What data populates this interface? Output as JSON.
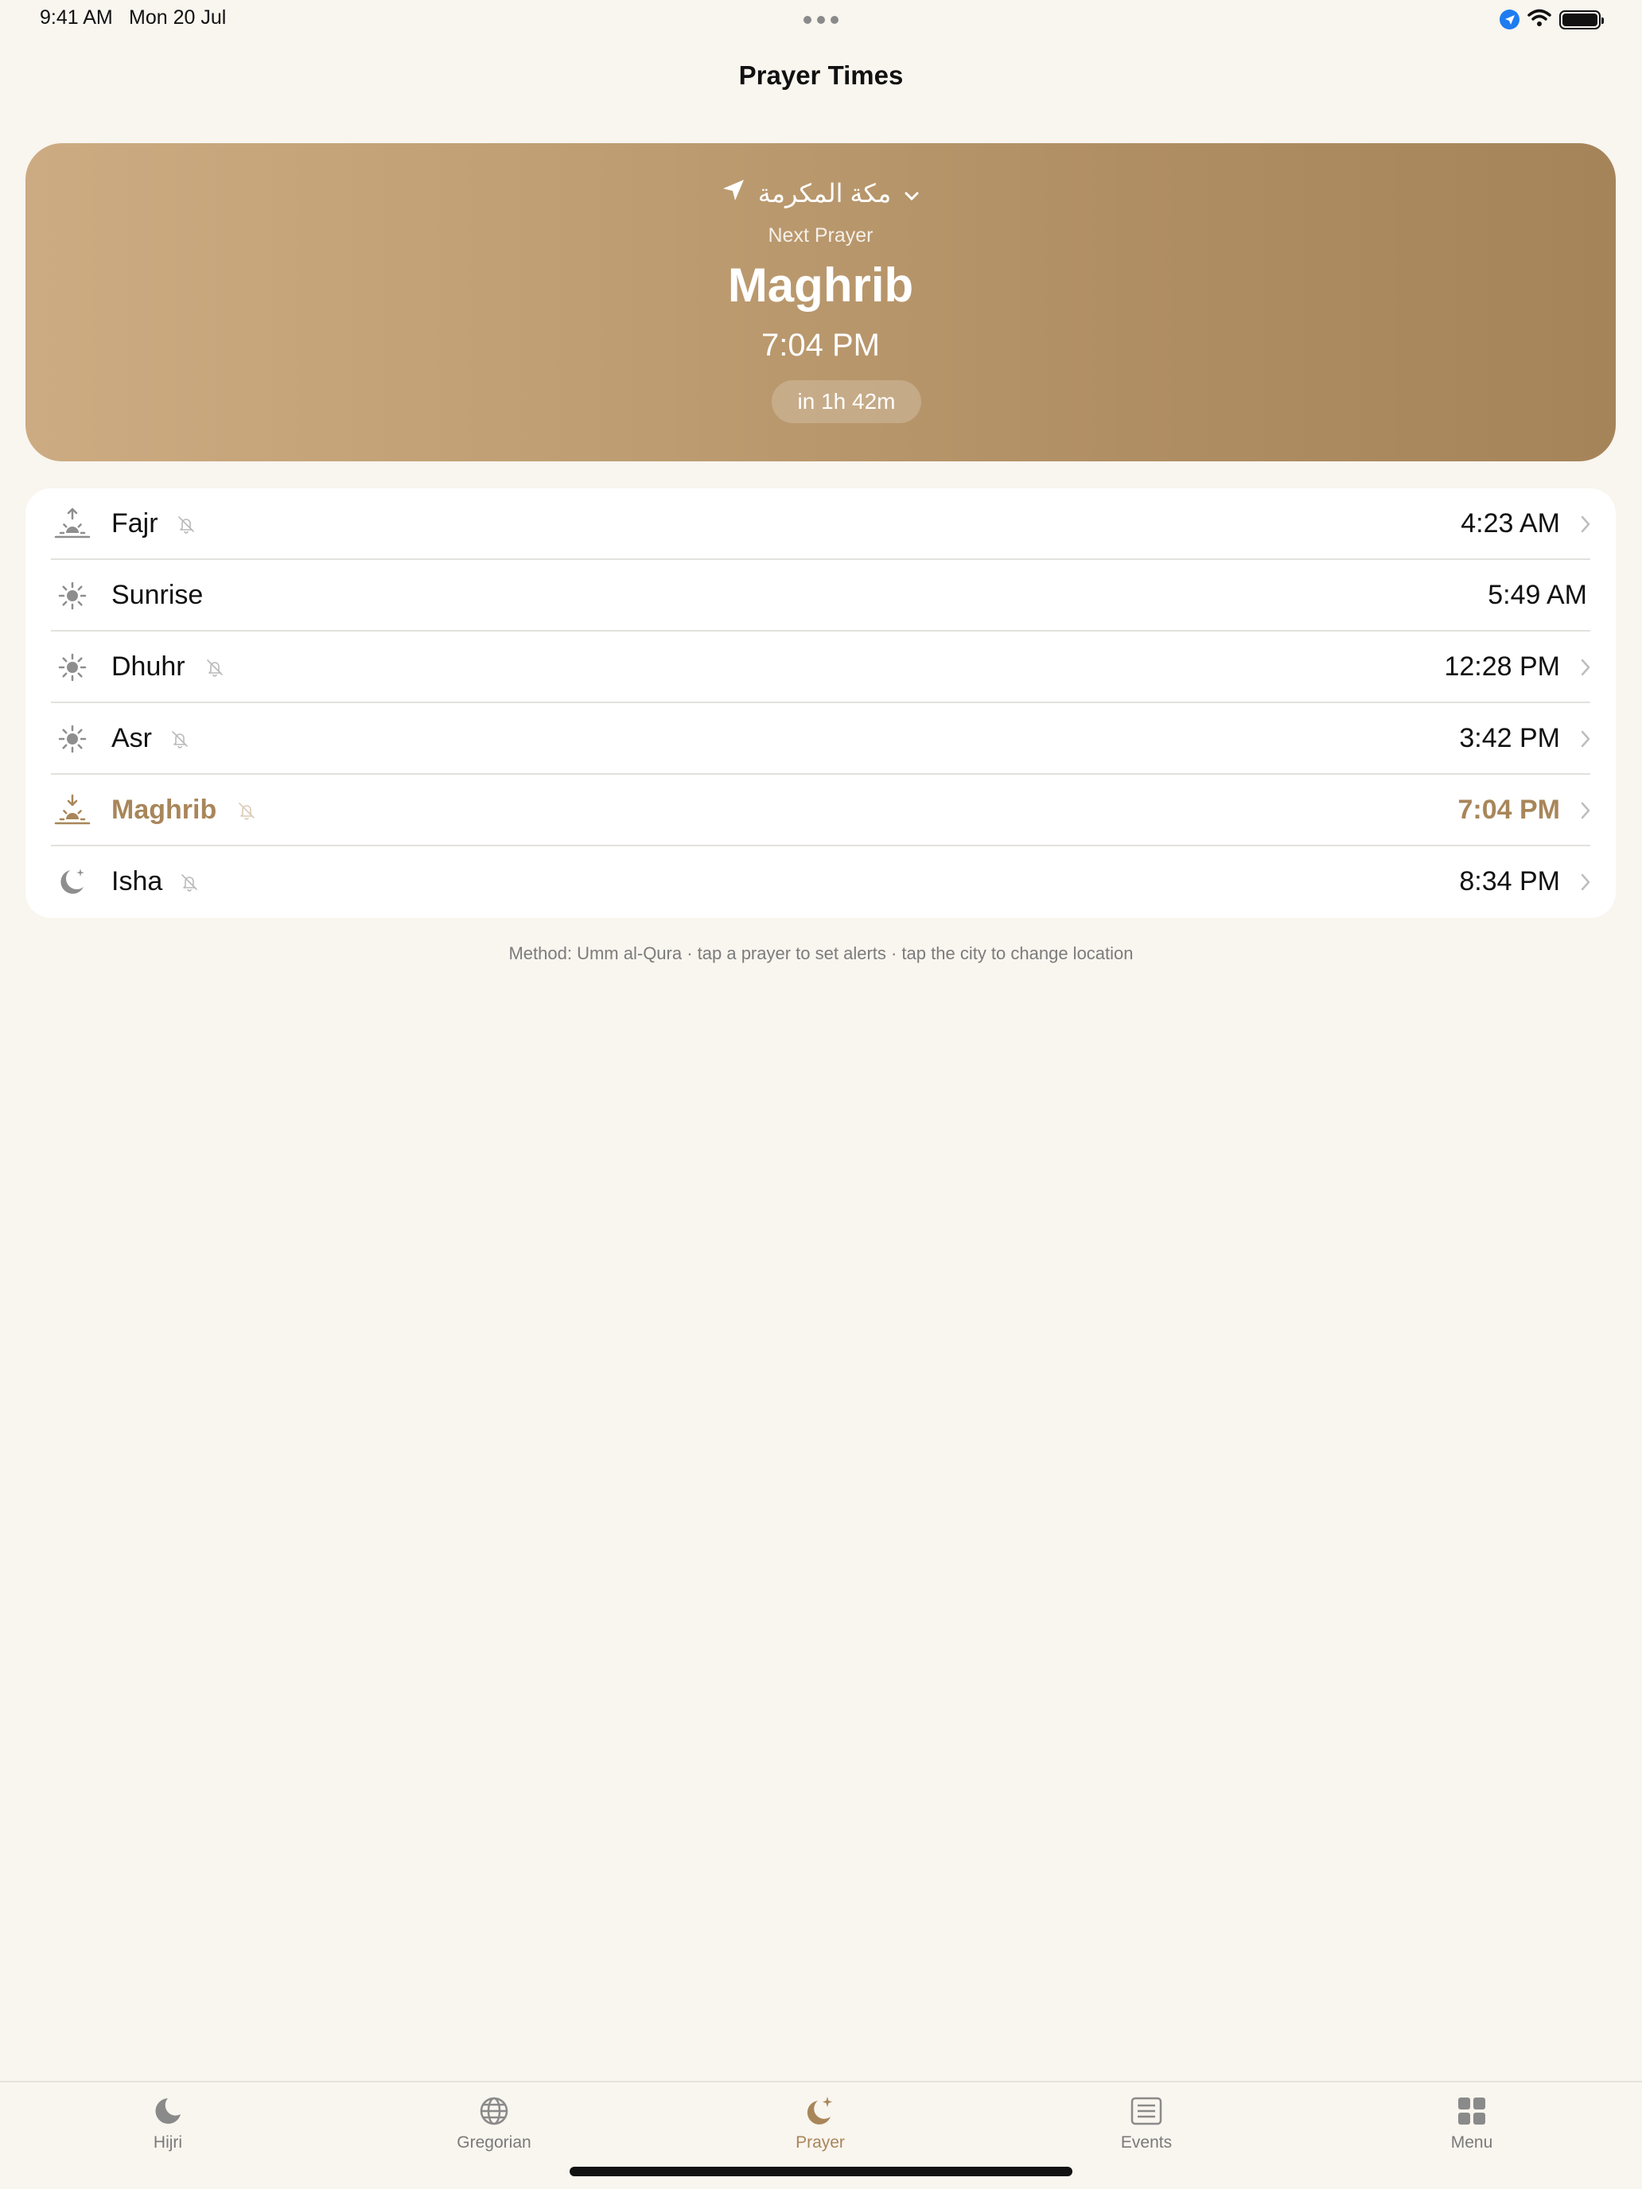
{
  "status_bar": {
    "time": "9:41 AM",
    "date": "Mon 20 Jul",
    "icons": [
      "location-icon",
      "wifi-icon",
      "battery-icon"
    ]
  },
  "nav": {
    "title": "Prayer Times"
  },
  "hero": {
    "city": "مكة المكرمة",
    "label": "Next Prayer",
    "prayer": "Maghrib",
    "time": "7:04 PM",
    "countdown": "in 1h 42m"
  },
  "prayers": [
    {
      "name": "Fajr",
      "time": "4:23 AM",
      "icon": "sunrise-up-icon",
      "bell": true,
      "chevron": true,
      "active": false
    },
    {
      "name": "Sunrise",
      "time": "5:49 AM",
      "icon": "sun-icon",
      "bell": false,
      "chevron": false,
      "active": false
    },
    {
      "name": "Dhuhr",
      "time": "12:28 PM",
      "icon": "sun-icon",
      "bell": true,
      "chevron": true,
      "active": false
    },
    {
      "name": "Asr",
      "time": "3:42 PM",
      "icon": "sun-icon",
      "bell": true,
      "chevron": true,
      "active": false
    },
    {
      "name": "Maghrib",
      "time": "7:04 PM",
      "icon": "sunset-down-icon",
      "bell": true,
      "chevron": true,
      "active": true
    },
    {
      "name": "Isha",
      "time": "8:34 PM",
      "icon": "moon-stars-icon",
      "bell": true,
      "chevron": true,
      "active": false
    }
  ],
  "footnote": "Method: Umm al-Qura · tap a prayer to set alerts · tap the city to change location",
  "tabs": [
    {
      "label": "Hijri",
      "icon": "moon-icon",
      "active": false
    },
    {
      "label": "Gregorian",
      "icon": "globe-icon",
      "active": false
    },
    {
      "label": "Prayer",
      "icon": "moon-star-icon",
      "active": true
    },
    {
      "label": "Events",
      "icon": "list-icon",
      "active": false
    },
    {
      "label": "Menu",
      "icon": "grid-icon",
      "active": false
    }
  ],
  "colors": {
    "background": "#f9f5ef",
    "accent": "#a8865a",
    "hero_start": "#cdab82",
    "hero_end": "#a6845a"
  }
}
